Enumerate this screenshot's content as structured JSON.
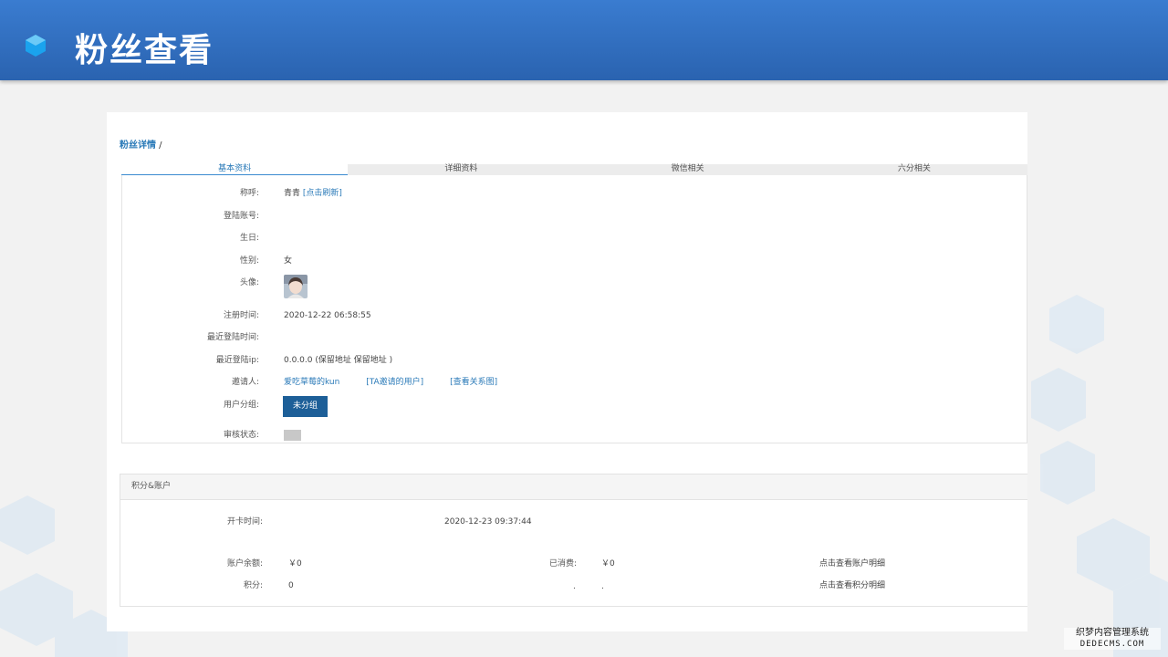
{
  "header": {
    "title": "粉丝查看"
  },
  "breadcrumb": {
    "link": "粉丝详情",
    "separator": " /"
  },
  "tabs": [
    {
      "label": "基本资料",
      "active": true
    },
    {
      "label": "详细资料",
      "active": false
    },
    {
      "label": "微信相关",
      "active": false
    },
    {
      "label": "六分相关",
      "active": false
    }
  ],
  "profile": {
    "nickname": {
      "label": "称呼:",
      "value": "青青",
      "refresh": "[点击刷新]"
    },
    "login_account": {
      "label": "登陆账号:",
      "value": ""
    },
    "birthday": {
      "label": "生日:",
      "value": ""
    },
    "gender": {
      "label": "性别:",
      "value": "女"
    },
    "avatar": {
      "label": "头像:"
    },
    "register_time": {
      "label": "注册时间:",
      "value": "2020-12-22 06:58:55"
    },
    "last_login_time": {
      "label": "最近登陆时间:",
      "value": ""
    },
    "last_login_ip": {
      "label": "最近登陆ip:",
      "value": "0.0.0.0 (保留地址 保留地址 )"
    },
    "inviter": {
      "label": "邀请人:",
      "name": "爱吃草莓的kun",
      "invited_users": "[TA邀请的用户]",
      "relation": "[查看关系图]"
    },
    "user_group": {
      "label": "用户分组:",
      "button": "未分组"
    },
    "review_status": {
      "label": "审核状态:"
    }
  },
  "points": {
    "section_title": "积分&账户",
    "card_time": {
      "label": "开卡时间:",
      "value": "2020-12-23 09:37:44"
    },
    "balance": {
      "label": "账户余额:",
      "value": "￥0"
    },
    "consumed": {
      "label": "已消费:",
      "value": "￥0"
    },
    "balance_link": "点击查看账户明细",
    "score": {
      "label": "积分:",
      "value": "0"
    },
    "score_mid1": ".",
    "score_mid2": ".",
    "score_link": "点击查看积分明细"
  },
  "watermark": {
    "line1": "织梦内容管理系统",
    "line2": "DEDECMS.COM"
  },
  "colors": {
    "banner": "#3a7cd0",
    "link": "#2a7ab8",
    "group_button": "#1d5f98"
  }
}
